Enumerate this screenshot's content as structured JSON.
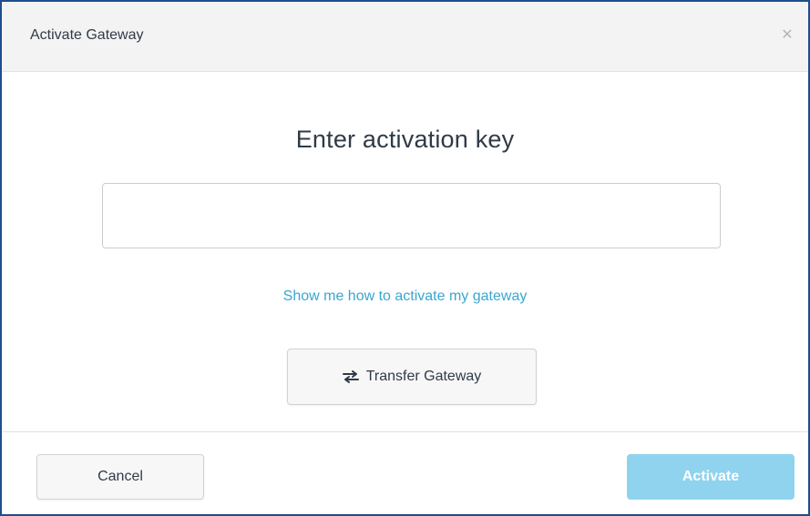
{
  "dialog": {
    "title": "Activate Gateway",
    "close_icon": "close-icon"
  },
  "main": {
    "heading": "Enter activation key",
    "key_input": {
      "value": "",
      "placeholder": ""
    },
    "help_link": "Show me how to activate my gateway",
    "transfer_button": {
      "label": "Transfer Gateway",
      "icon": "swap-arrows-icon"
    }
  },
  "footer": {
    "cancel_label": "Cancel",
    "activate_label": "Activate"
  },
  "colors": {
    "frame_border": "#1f4e8c",
    "header_bg": "#f3f3f3",
    "link": "#3aa6d0",
    "activate_bg": "#8fd3ef",
    "text": "#2f3b47"
  }
}
